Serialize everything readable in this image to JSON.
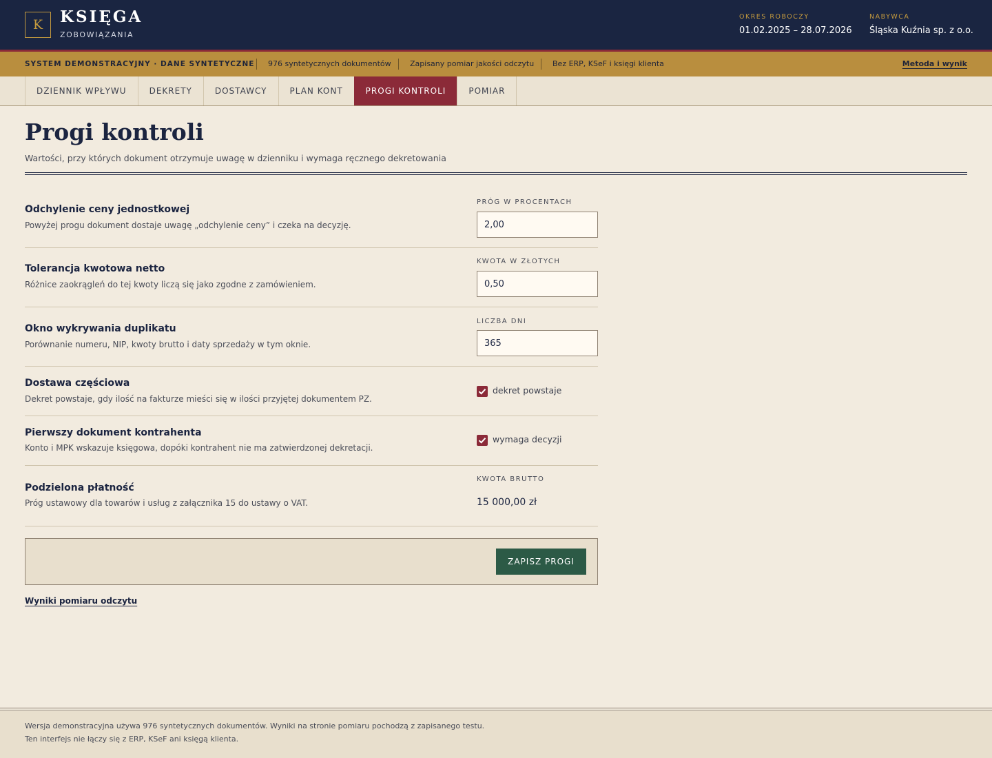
{
  "header": {
    "logo_letter": "K",
    "brand_title": "KSIĘGA",
    "brand_subtitle": "ZOBOWIĄZANIA",
    "period_label": "OKRES ROBOCZY",
    "period_value": "01.02.2025 – 28.07.2026",
    "buyer_label": "NABYWCA",
    "buyer_value": "Śląska Kuźnia sp. z o.o."
  },
  "infobar": {
    "system_label": "SYSTEM DEMONSTRACYJNY · DANE SYNTETYCZNE",
    "documents": "976 syntetycznych dokumentów",
    "measurement": "Zapisany pomiar jakości odczytu",
    "no_erp": "Bez ERP, KSeF i księgi klienta",
    "method_link": "Metoda i wynik"
  },
  "nav": {
    "tabs": [
      {
        "label": "DZIENNIK WPŁYWU"
      },
      {
        "label": "DEKRETY"
      },
      {
        "label": "DOSTAWCY"
      },
      {
        "label": "PLAN KONT"
      },
      {
        "label": "PROGI KONTROLI"
      },
      {
        "label": "POMIAR"
      }
    ],
    "active_index": 4
  },
  "main": {
    "title": "Progi kontroli",
    "subtitle": "Wartości, przy których dokument otrzymuje uwagę w dzienniku i wymaga ręcznego dekretowania",
    "settings": [
      {
        "title": "Odchylenie ceny jednostkowej",
        "description": "Powyżej progu dokument dostaje uwagę „odchylenie ceny” i czeka na decyzję.",
        "field_label": "PRÓG W PROCENTACH",
        "value": "2,00"
      },
      {
        "title": "Tolerancja kwotowa netto",
        "description": "Różnice zaokrągleń do tej kwoty liczą się jako zgodne z zamówieniem.",
        "field_label": "KWOTA W ZŁOTYCH",
        "value": "0,50"
      },
      {
        "title": "Okno wykrywania duplikatu",
        "description": "Porównanie numeru, NIP, kwoty brutto i daty sprzedaży w tym oknie.",
        "field_label": "LICZBA DNI",
        "value": "365"
      },
      {
        "title": "Dostawa częściowa",
        "description": "Dekret powstaje, gdy ilość na fakturze mieści się w ilości przyjętej dokumentem PZ.",
        "checkbox_label": "dekret powstaje",
        "checked": true
      },
      {
        "title": "Pierwszy dokument kontrahenta",
        "description": "Konto i MPK wskazuje księgowa, dopóki kontrahent nie ma zatwierdzonej dekretacji.",
        "checkbox_label": "wymaga decyzji",
        "checked": true
      },
      {
        "title": "Podzielona płatność",
        "description": "Próg ustawowy dla towarów i usług z załącznika 15 do ustawy o VAT.",
        "field_label": "KWOTA BRUTTO",
        "value": "15 000,00 zł"
      }
    ],
    "save_button": "ZAPISZ PROGI",
    "results_link": "Wyniki pomiaru odczytu"
  },
  "footer": {
    "line1": "Wersja demonstracyjna używa 976 syntetycznych dokumentów. Wyniki na stronie pomiaru pochodzą z zapisanego testu.",
    "line2": "Ten interfejs nie łączy się z ERP, KSeF ani księgą klienta."
  },
  "colors": {
    "navy": "#1a2541",
    "gold": "#b98e3e",
    "crimson": "#8b2a38",
    "green_button": "#2c5a46",
    "page_background": "#f2ebdf"
  }
}
